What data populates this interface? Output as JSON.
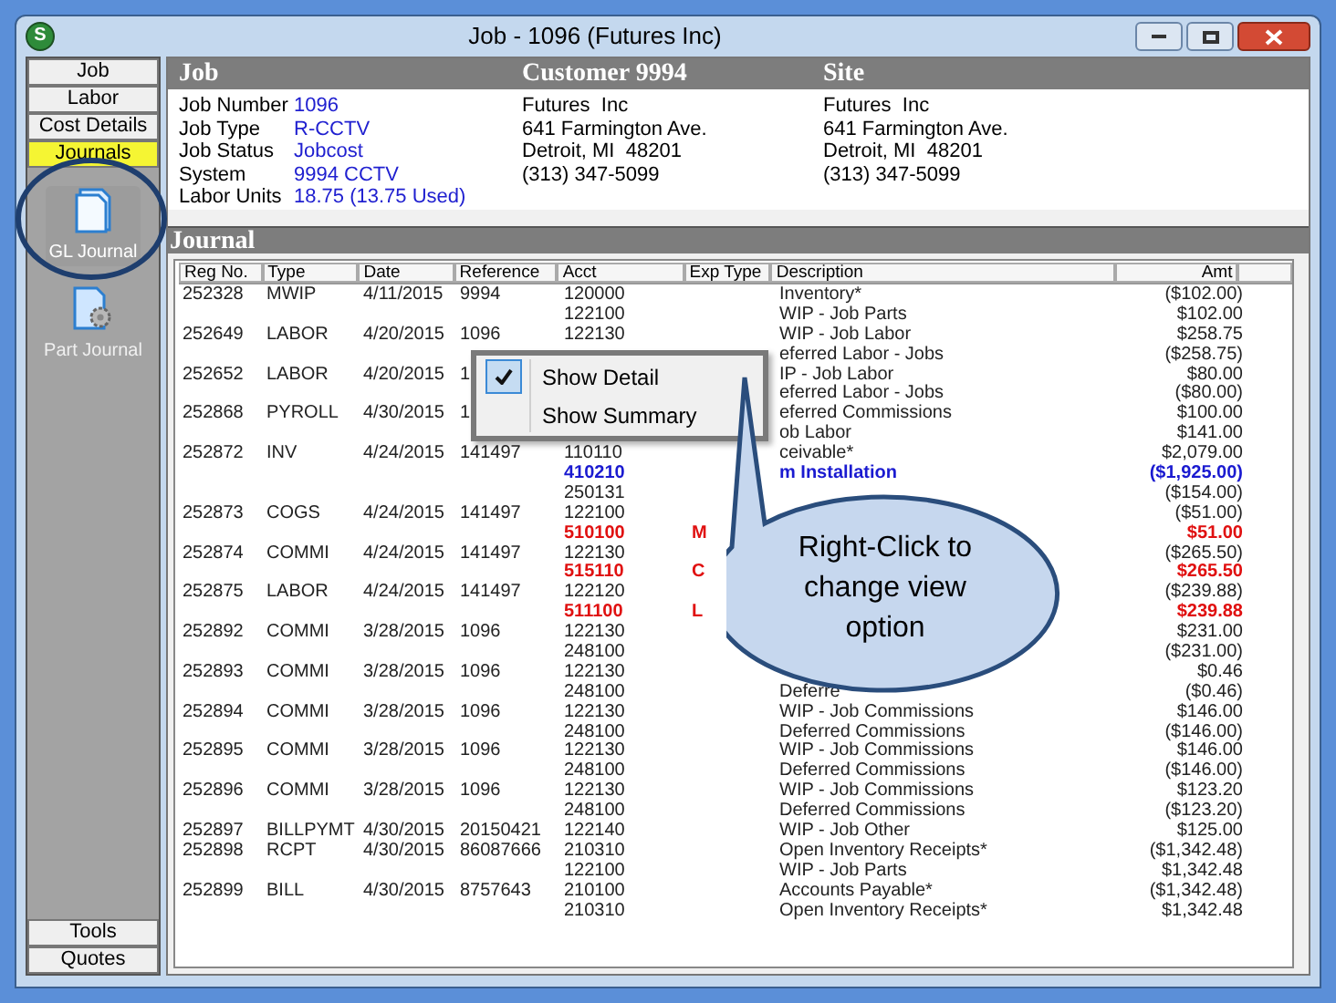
{
  "window": {
    "title": "Job - 1096 (Futures  Inc)",
    "app_icon_letter": "S"
  },
  "sidebar": {
    "tabs": [
      {
        "label": "Job",
        "selected": false
      },
      {
        "label": "Labor",
        "selected": false
      },
      {
        "label": "Cost Details",
        "selected": false
      },
      {
        "label": "Journals",
        "selected": true
      }
    ],
    "items": [
      {
        "label": "GL Journal",
        "kind": "gl",
        "selected": true
      },
      {
        "label": "Part Journal",
        "kind": "part",
        "selected": false
      }
    ],
    "bottom_tabs": [
      {
        "label": "Tools",
        "selected": false
      },
      {
        "label": "Quotes",
        "selected": false
      }
    ]
  },
  "header": {
    "job_title": "Job",
    "customer_title": "Customer 9994",
    "site_title": "Site",
    "job_fields": [
      {
        "label": "Job Number",
        "value": "1096"
      },
      {
        "label": "Job Type",
        "value": "R-CCTV"
      },
      {
        "label": "Job Status",
        "value": "Jobcost"
      },
      {
        "label": "System",
        "value": "9994 CCTV"
      },
      {
        "label": "Labor Units",
        "value": "18.75 (13.75 Used)"
      }
    ],
    "customer_lines": [
      "Futures  Inc",
      "641 Farmington Ave.",
      "Detroit, MI  48201",
      "(313) 347-5099"
    ],
    "site_lines": [
      "Futures  Inc",
      "641 Farmington Ave.",
      "Detroit, MI  48201",
      "(313) 347-5099"
    ]
  },
  "journal": {
    "title": "Journal",
    "columns": [
      "Reg No.",
      "Type",
      "Date",
      "Reference",
      "Acct",
      "Exp Type",
      "Description",
      "Amt"
    ],
    "lines": [
      {
        "kind": "normal",
        "reg_no": "252328",
        "type": "MWIP",
        "date": "4/11/2015",
        "reference": "9994",
        "acct": "120000",
        "description": "Inventory*",
        "amt": "($102.00)"
      },
      {
        "kind": "normal",
        "acct": "122100",
        "description": "WIP - Job Parts",
        "amt": "$102.00"
      },
      {
        "kind": "normal",
        "reg_no": "252649",
        "type": "LABOR",
        "date": "4/20/2015",
        "reference": "1096",
        "acct": "122130",
        "description": "WIP - Job Labor",
        "amt": "$258.75"
      },
      {
        "kind": "normal",
        "description": "eferred Labor - Jobs",
        "amt": "($258.75)"
      },
      {
        "kind": "normal",
        "reg_no": "252652",
        "type": "LABOR",
        "date": "4/20/2015",
        "reference": "1",
        "description": "IP - Job Labor",
        "amt": "$80.00"
      },
      {
        "kind": "normal",
        "description": "eferred Labor - Jobs",
        "amt": "($80.00)"
      },
      {
        "kind": "normal",
        "reg_no": "252868",
        "type": "PYROLL",
        "date": "4/30/2015",
        "reference": "1",
        "description": "eferred Commissions",
        "amt": "$100.00"
      },
      {
        "kind": "normal",
        "description": "ob Labor",
        "amt": "$141.00"
      },
      {
        "kind": "normal",
        "reg_no": "252872",
        "type": "INV",
        "date": "4/24/2015",
        "reference": "141497",
        "acct": "110110",
        "description": "ceivable*",
        "amt": "$2,079.00"
      },
      {
        "kind": "blue",
        "acct": "410210",
        "description": "m Installation",
        "amt": "($1,925.00)"
      },
      {
        "kind": "normal",
        "acct": "250131",
        "amt": "($154.00)"
      },
      {
        "kind": "normal",
        "reg_no": "252873",
        "type": "COGS",
        "date": "4/24/2015",
        "reference": "141497",
        "acct": "122100",
        "amt": "($51.00)"
      },
      {
        "kind": "red",
        "acct": "510100",
        "exp_type": "M",
        "amt": "$51.00"
      },
      {
        "kind": "normal",
        "reg_no": "252874",
        "type": "COMMI",
        "date": "4/24/2015",
        "reference": "141497",
        "acct": "122130",
        "amt": "($265.50)"
      },
      {
        "kind": "red",
        "acct": "515110",
        "exp_type": "C",
        "amt": "$265.50"
      },
      {
        "kind": "normal",
        "reg_no": "252875",
        "type": "LABOR",
        "date": "4/24/2015",
        "reference": "141497",
        "acct": "122120",
        "amt": "($239.88)"
      },
      {
        "kind": "red",
        "acct": "511100",
        "exp_type": "L",
        "amt": "$239.88"
      },
      {
        "kind": "normal",
        "reg_no": "252892",
        "type": "COMMI",
        "date": "3/28/2015",
        "reference": "1096",
        "acct": "122130",
        "amt": "$231.00"
      },
      {
        "kind": "normal",
        "acct": "248100",
        "amt": "($231.00)"
      },
      {
        "kind": "normal",
        "reg_no": "252893",
        "type": "COMMI",
        "date": "3/28/2015",
        "reference": "1096",
        "acct": "122130",
        "amt": "$0.46"
      },
      {
        "kind": "normal",
        "acct": "248100",
        "description": "Deferre",
        "amt": "($0.46)"
      },
      {
        "kind": "normal",
        "reg_no": "252894",
        "type": "COMMI",
        "date": "3/28/2015",
        "reference": "1096",
        "acct": "122130",
        "description": "WIP - Job Commissions",
        "amt": "$146.00"
      },
      {
        "kind": "normal",
        "acct": "248100",
        "description": "Deferred Commissions",
        "amt": "($146.00)"
      },
      {
        "kind": "normal",
        "reg_no": "252895",
        "type": "COMMI",
        "date": "3/28/2015",
        "reference": "1096",
        "acct": "122130",
        "description": "WIP - Job Commissions",
        "amt": "$146.00"
      },
      {
        "kind": "normal",
        "acct": "248100",
        "description": "Deferred Commissions",
        "amt": "($146.00)"
      },
      {
        "kind": "normal",
        "reg_no": "252896",
        "type": "COMMI",
        "date": "3/28/2015",
        "reference": "1096",
        "acct": "122130",
        "description": "WIP - Job Commissions",
        "amt": "$123.20"
      },
      {
        "kind": "normal",
        "acct": "248100",
        "description": "Deferred Commissions",
        "amt": "($123.20)"
      },
      {
        "kind": "normal",
        "reg_no": "252897",
        "type": "BILLPYMT",
        "date": "4/30/2015",
        "reference": "20150421",
        "acct": "122140",
        "description": "WIP - Job Other",
        "amt": "$125.00"
      },
      {
        "kind": "normal",
        "reg_no": "252898",
        "type": "RCPT",
        "date": "4/30/2015",
        "reference": "86087666",
        "acct": "210310",
        "description": "Open Inventory Receipts*",
        "amt": "($1,342.48)"
      },
      {
        "kind": "normal",
        "acct": "122100",
        "description": "WIP - Job Parts",
        "amt": "$1,342.48"
      },
      {
        "kind": "normal",
        "reg_no": "252899",
        "type": "BILL",
        "date": "4/30/2015",
        "reference": "8757643",
        "acct": "210100",
        "description": "Accounts Payable*",
        "amt": "($1,342.48)"
      },
      {
        "kind": "normal",
        "acct": "210310",
        "description": "Open Inventory Receipts*",
        "amt": "$1,342.48"
      }
    ]
  },
  "context_menu": {
    "items": [
      {
        "label": "Show Detail",
        "checked": true
      },
      {
        "label": "Show Summary",
        "checked": false
      }
    ]
  },
  "callout": {
    "lines": [
      "Right-Click to",
      "change view",
      "option"
    ]
  }
}
